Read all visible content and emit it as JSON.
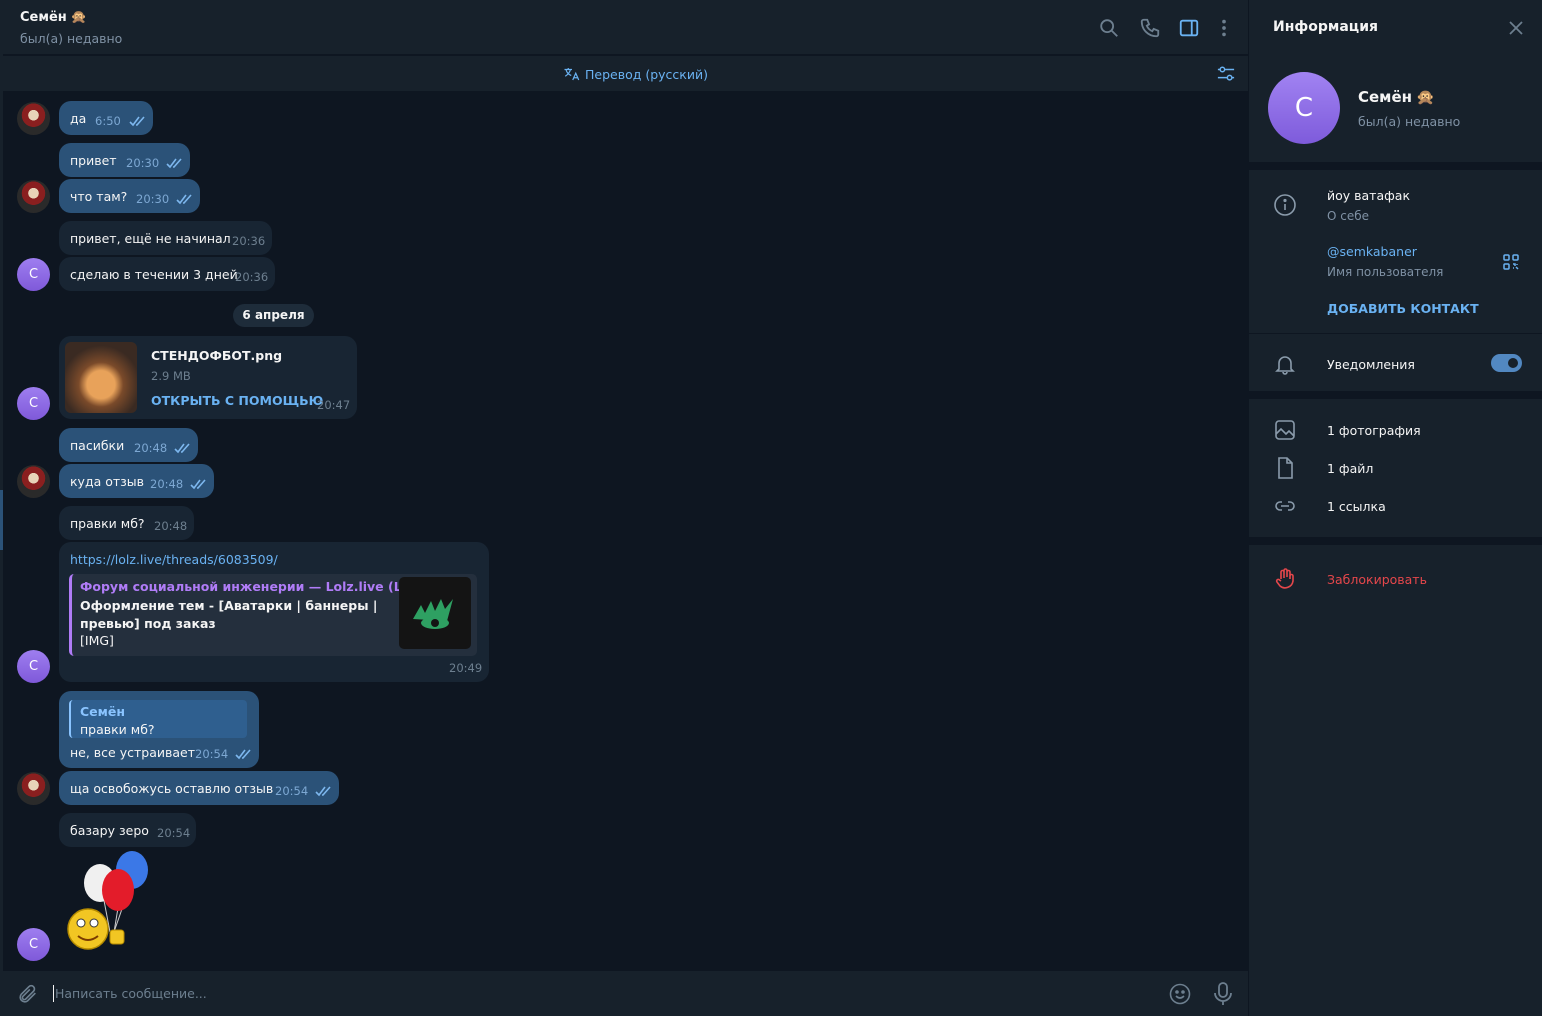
{
  "chat": {
    "name": "Семён",
    "status": "был(а) недавно",
    "translate_label": "Перевод (русский)",
    "date_divider": "6 апреля",
    "input_placeholder": "Написать сообщение...",
    "messages": [
      {
        "dir": "out",
        "text": "да",
        "time": "6:50"
      },
      {
        "dir": "out",
        "text": "привет",
        "time": "20:30"
      },
      {
        "dir": "out",
        "text": "что там?",
        "time": "20:30"
      },
      {
        "dir": "in",
        "text": "привет, ещё не начинал",
        "time": "20:36"
      },
      {
        "dir": "in",
        "text": "сделаю в течении 3 дней",
        "time": "20:36"
      },
      {
        "dir": "in",
        "type": "file",
        "file_name": "СТЕНДОФБОТ.png",
        "file_size": "2.9 MB",
        "action": "ОТКРЫТЬ С ПОМОЩЬЮ",
        "time": "20:47"
      },
      {
        "dir": "out",
        "text": "пасибки",
        "time": "20:48"
      },
      {
        "dir": "out",
        "text": "куда отзыв",
        "time": "20:48"
      },
      {
        "dir": "in",
        "text": "правки мб?",
        "time": "20:48"
      },
      {
        "dir": "in",
        "type": "link",
        "url": "https://lolz.live/threads/6083509/",
        "preview_site": "Форум социальной инженерии — Lolz.live (L...",
        "preview_title": "Оформление тем - [Аватарки | баннеры | превью] под заказ",
        "preview_extra": "[IMG]",
        "time": "20:49"
      },
      {
        "dir": "out",
        "type": "reply",
        "reply_name": "Семён",
        "reply_text": "правки мб?",
        "text": "не, все устраивает",
        "time": "20:54"
      },
      {
        "dir": "out",
        "text": "ща освобожусь оставлю отзыв",
        "time": "20:54"
      },
      {
        "dir": "in",
        "text": "базару зеро",
        "time": "20:54"
      }
    ]
  },
  "info": {
    "title": "Информация",
    "name": "Семён",
    "status": "был(а) недавно",
    "avatar_letter": "С",
    "bio": "йоу ватафак",
    "bio_label": "О себе",
    "username": "@semkabaner",
    "username_label": "Имя пользователя",
    "add_contact": "ДОБАВИТЬ КОНТАКТ",
    "notifications": "Уведомления",
    "notifications_on": true,
    "media_photos": "1 фотография",
    "media_files": "1 файл",
    "media_links": "1 ссылка",
    "block": "Заблокировать"
  },
  "colors": {
    "accent": "#6ab2f2",
    "bubble_out": "#2b5278",
    "bubble_in": "#182533",
    "danger": "#e5474b",
    "purple_link": "#b07cf7"
  }
}
